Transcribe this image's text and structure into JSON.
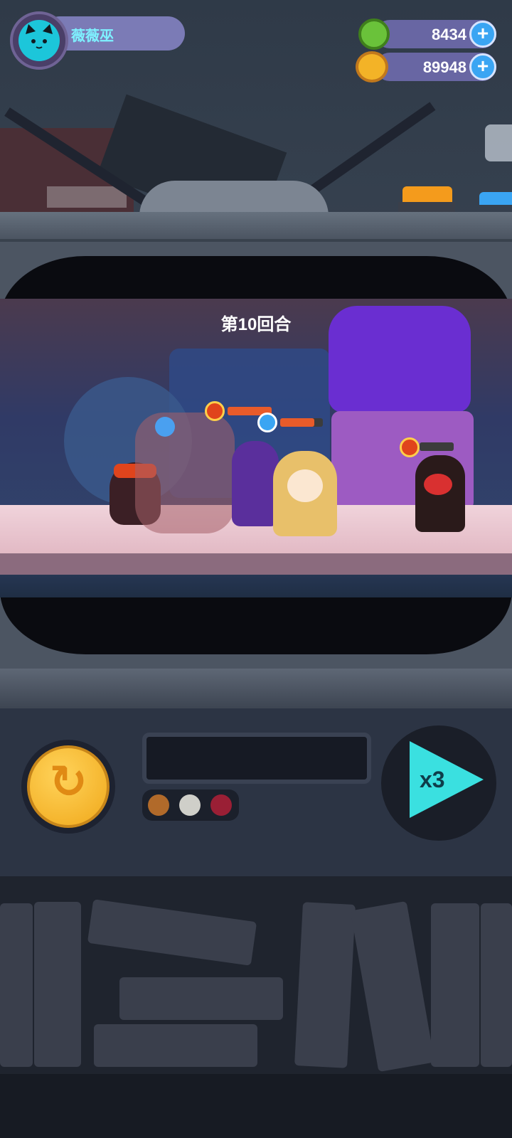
{
  "player": {
    "name": "薇薇巫",
    "avatar_icon": "cat-face-icon"
  },
  "currency": [
    {
      "name": "green-gem",
      "value": "8434",
      "icon": "green-coin-icon",
      "color": "#6ac23a"
    },
    {
      "name": "gold-coin",
      "value": "89948",
      "icon": "gold-coin-icon",
      "color": "#f3b327"
    }
  ],
  "battle": {
    "round_label": "第10回合"
  },
  "controls": {
    "speed_label": "x3",
    "restart_icon": "restart-icon",
    "speed_icon": "play-icon"
  },
  "status_dots": [
    {
      "name": "orange-dot",
      "color": "#b16a2a"
    },
    {
      "name": "white-dot",
      "color": "#cfcfc9"
    },
    {
      "name": "red-dot",
      "color": "#9a1f35"
    }
  ],
  "colors": {
    "accent_cyan": "#3ae0e0",
    "pill_purple": "#6866a3",
    "plus_blue": "#3aa5f3",
    "gold": "#f0a81a"
  }
}
